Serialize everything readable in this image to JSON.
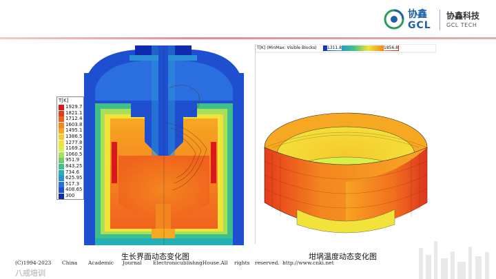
{
  "brand": {
    "logo_cn": "协鑫",
    "logo_en": "GCL",
    "company_cn": "协鑫科技",
    "company_en": "GCL TECH",
    "primary_color": "#1f5fa6",
    "accent_color": "#e07878"
  },
  "left_figure": {
    "caption": "生长界面动态变化图",
    "legend": {
      "title": "T[K]",
      "values": [
        "1929.7",
        "1821.1",
        "1712.4",
        "1603.8",
        "1495.1",
        "1386.5",
        "1277.8",
        "1169.2",
        "1060.5",
        "951.9",
        "843.25",
        "734.6",
        "625.95",
        "517.3",
        "408.65",
        "300"
      ],
      "colors": [
        "#d7191c",
        "#e63b1b",
        "#f0621d",
        "#f4861f",
        "#f7a823",
        "#f6c92c",
        "#f2e33b",
        "#d9ef4a",
        "#a8e05a",
        "#6fd06a",
        "#3fc08a",
        "#25b0b8",
        "#2a8fd6",
        "#2b6ee0",
        "#1d4fd0",
        "#0e2bb0"
      ]
    }
  },
  "right_figure": {
    "caption": "坩埚温度动态变化图",
    "colorbar": {
      "title": "T[K] (MinMax: Visible Blocks)",
      "min": "1311.8",
      "max": "1856.8"
    }
  },
  "footer": {
    "parts": [
      "(C)1994-2023",
      "China",
      "Academic",
      "Journal",
      "ElectronicublishngHouse.All",
      "rights",
      "reserved.",
      "http://www.cnki.net"
    ]
  },
  "watermark": "八戒培训"
}
